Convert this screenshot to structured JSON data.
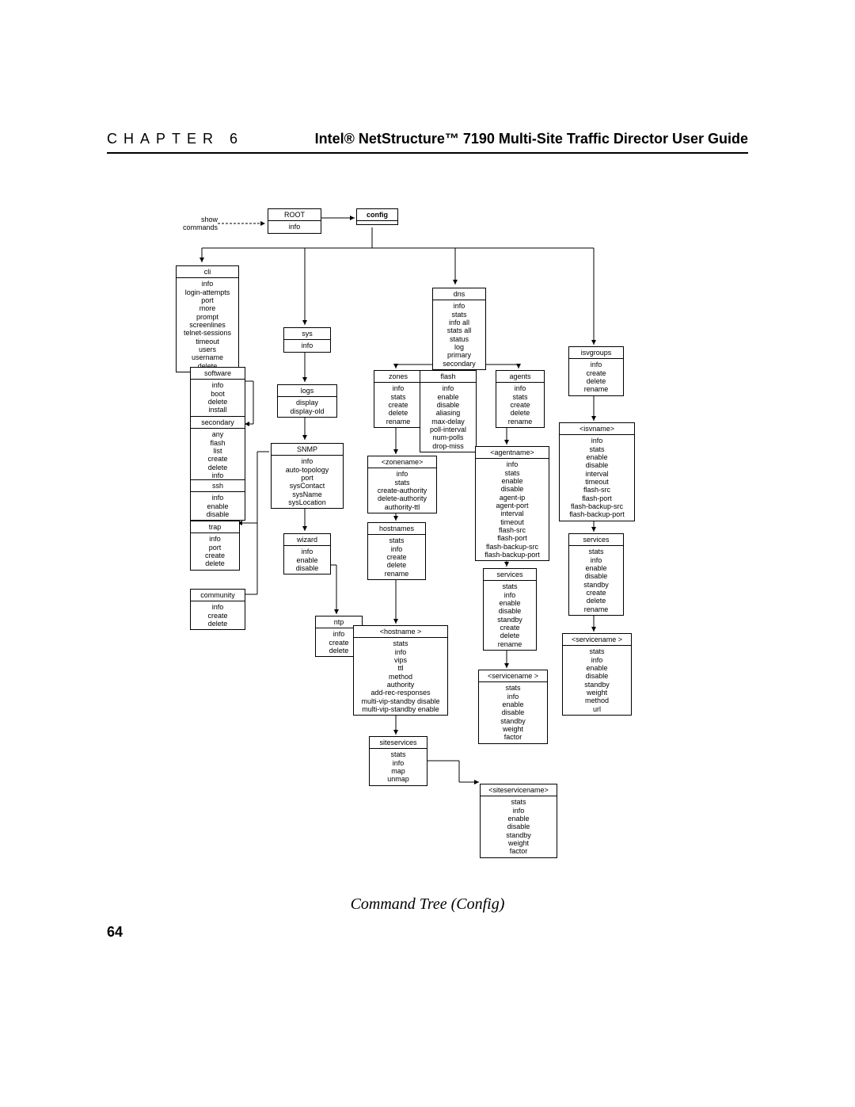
{
  "header": {
    "chapter_label": "CHAPTER 6",
    "doc_title": "Intel® NetStructure™ 7190 Multi-Site Traffic Director User Guide"
  },
  "page_number": "64",
  "caption": "Command Tree (Config)",
  "show_commands_label": "show\ncommands",
  "root": {
    "title": "ROOT",
    "items": [
      "info"
    ]
  },
  "config": {
    "title": "config",
    "items": []
  },
  "cli": {
    "title": "cli",
    "items": [
      "info",
      "login-attempts",
      "port",
      "more",
      "prompt",
      "screenlines",
      "telnet-sessions",
      "timeout",
      "users",
      "username",
      "delete"
    ]
  },
  "software": {
    "title": "software",
    "items": [
      "info",
      "boot",
      "delete",
      "install"
    ]
  },
  "secondary_box": {
    "title": "secondary",
    "items": [
      "any",
      "flash",
      "list",
      "create",
      "delete",
      "info"
    ]
  },
  "ssh": {
    "title": "ssh",
    "items": [
      "info",
      "enable",
      "disable"
    ]
  },
  "trap": {
    "title": "trap",
    "items": [
      "info",
      "port",
      "create",
      "delete"
    ]
  },
  "community": {
    "title": "community",
    "items": [
      "info",
      "create",
      "delete"
    ]
  },
  "sys": {
    "title": "sys",
    "items": [
      "info"
    ]
  },
  "logs": {
    "title": "logs",
    "items": [
      "display",
      "display-old"
    ]
  },
  "snmp": {
    "title": "SNMP",
    "items": [
      "info",
      "auto-topology",
      "port",
      "sysContact",
      "sysName",
      "sysLocation"
    ]
  },
  "wizard": {
    "title": "wizard",
    "items": [
      "info",
      "enable",
      "disable"
    ]
  },
  "ntp": {
    "title": "ntp",
    "items": [
      "info",
      "create",
      "delete"
    ]
  },
  "dns": {
    "title": "dns",
    "items": [
      "info",
      "stats",
      "info all",
      "stats all",
      "status",
      "log",
      "primary",
      "secondary"
    ]
  },
  "zones": {
    "title": "zones",
    "items": [
      "info",
      "stats",
      "create",
      "delete",
      "rename"
    ]
  },
  "flash": {
    "title": "flash",
    "items": [
      "info",
      "enable",
      "disable",
      "aliasing",
      "max-delay",
      "poll-interval",
      "num-polls",
      "drop-miss"
    ]
  },
  "agents": {
    "title": "agents",
    "items": [
      "info",
      "stats",
      "create",
      "delete",
      "rename"
    ]
  },
  "zonename": {
    "title": "<zonename>",
    "items": [
      "info",
      "stats",
      "create-authority",
      "delete-authority",
      "authority-ttl"
    ]
  },
  "hostnames": {
    "title": "hostnames",
    "items": [
      "stats",
      "info",
      "create",
      "delete",
      "rename"
    ]
  },
  "hostname": {
    "title": "<hostname >",
    "items": [
      "stats",
      "info",
      "vips",
      "ttl",
      "method",
      "authority",
      "add-rec-responses",
      "multi-vip-standby disable",
      "multi-vip-standby enable"
    ]
  },
  "siteservices": {
    "title": "siteservices",
    "items": [
      "stats",
      "info",
      "map",
      "unmap"
    ]
  },
  "siteservicename": {
    "title": "<siteservicename>",
    "items": [
      "stats",
      "info",
      "enable",
      "disable",
      "standby",
      "weight",
      "factor"
    ]
  },
  "agentname": {
    "title": "<agentname>",
    "items": [
      "info",
      "stats",
      "enable",
      "disable",
      "agent-ip",
      "agent-port",
      "interval",
      "timeout",
      "flash-src",
      "flash-port",
      "flash-backup-src",
      "flash-backup-port"
    ]
  },
  "services_agent": {
    "title": "services",
    "items": [
      "stats",
      "info",
      "enable",
      "disable",
      "standby",
      "create",
      "delete",
      "rename"
    ]
  },
  "servicename_agent": {
    "title": "<servicename >",
    "items": [
      "stats",
      "info",
      "enable",
      "disable",
      "standby",
      "weight",
      "factor"
    ]
  },
  "isvgroups": {
    "title": "isvgroups",
    "items": [
      "info",
      "create",
      "delete",
      "rename"
    ]
  },
  "isvname": {
    "title": "<isvname>",
    "items": [
      "info",
      "stats",
      "enable",
      "disable",
      "interval",
      "timeout",
      "flash-src",
      "flash-port",
      "flash-backup-src",
      "flash-backup-port"
    ]
  },
  "services_isv": {
    "title": "services",
    "items": [
      "stats",
      "info",
      "enable",
      "disable",
      "standby",
      "create",
      "delete",
      "rename"
    ]
  },
  "servicename_isv": {
    "title": "<servicename >",
    "items": [
      "stats",
      "info",
      "enable",
      "disable",
      "standby",
      "weight",
      "method",
      "url"
    ]
  }
}
